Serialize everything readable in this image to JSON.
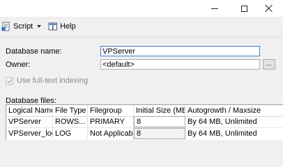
{
  "window": {
    "controls": {
      "minimize": "minimize",
      "maximize": "maximize",
      "close": "close"
    }
  },
  "toolbar": {
    "script_label": "Script",
    "help_label": "Help",
    "script_icon": "script-icon",
    "help_icon": "help-icon"
  },
  "form": {
    "database_name_label": "Database name:",
    "database_name_value": "VPServer",
    "owner_label": "Owner:",
    "owner_value": "<default>",
    "browse_label": "...",
    "fulltext_label": "Use full-text indexing",
    "fulltext_checked": true,
    "fulltext_enabled": false
  },
  "files": {
    "section_label": "Database files:",
    "columns": [
      "Logical Name",
      "File Type",
      "Filegroup",
      "Initial Size (MB)",
      "Autogrowth / Maxsize"
    ],
    "rows": [
      [
        "VPServer",
        "ROWS...",
        "PRIMARY",
        "8",
        "By 64 MB, Unlimited"
      ],
      [
        "VPServer_log",
        "LOG",
        "Not Applicable",
        "8",
        "By 64 MB, Unlimited"
      ]
    ]
  },
  "colors": {
    "focus_border": "#3c7fd4",
    "window_bg": "#f0f0f0",
    "disabled_text": "#8a8a8a"
  }
}
